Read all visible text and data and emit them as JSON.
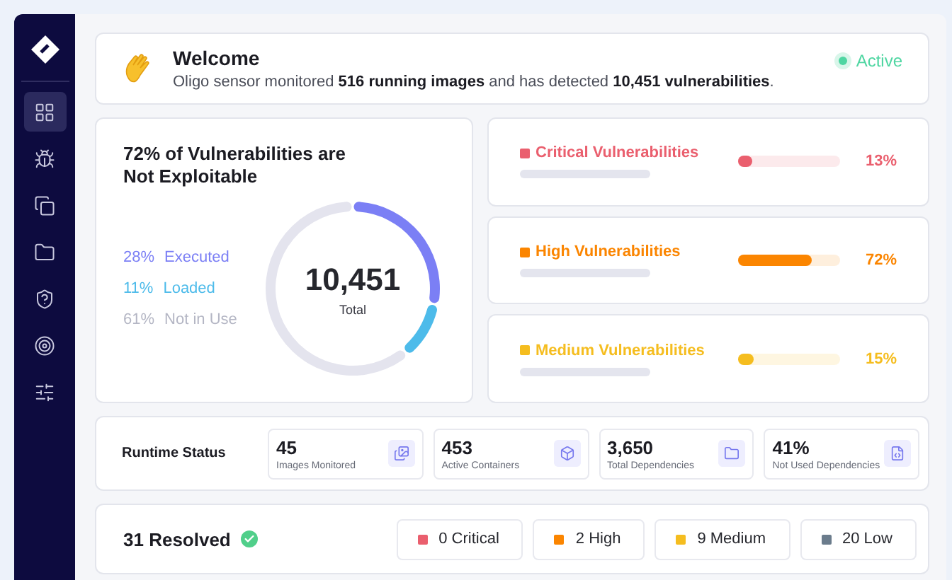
{
  "sidebar": {
    "items": [
      {
        "selected": true
      },
      {
        "selected": false
      },
      {
        "selected": false
      },
      {
        "selected": false
      },
      {
        "selected": false
      },
      {
        "selected": false
      },
      {
        "selected": false
      }
    ]
  },
  "welcome": {
    "title": "Welcome",
    "message": "Oligo sensor monitored **516 running images** and has detected **10,451 vulnerabilities**.",
    "status": "Active"
  },
  "exploitability": {
    "title": "72% of Vulnerabilities are Not Exploitable",
    "total": "10,451",
    "total_label": "Total",
    "legend": [
      {
        "percent": "28%",
        "color": "#7b7ff5"
      },
      {
        "percent": "11%",
        "color": "#4dbbea"
      },
      {
        "percent": "61%",
        "color": "#b4b6c4"
      }
    ],
    "chart_data": {
      "type": "donut",
      "categories": [
        "Executed",
        "Loaded",
        "Not in Use"
      ],
      "values": [
        28,
        11,
        61
      ]
    }
  },
  "severity_cards": [
    {
      "title": "Critical Vulnerabilities",
      "level": 0.13,
      "percent": "13%",
      "color": "#ea5f6e"
    },
    {
      "title": "High Vulnerabilities",
      "level": 0.72,
      "percent": "72%",
      "color": "#fb8500"
    },
    {
      "title": "Medium Vulnerabilities",
      "level": 0.15,
      "percent": "15%",
      "color": "#f5bd1f"
    }
  ],
  "runtime_status": {
    "title": "Runtime Status",
    "stats": [
      {
        "value": "45",
        "label": "Images Monitored"
      },
      {
        "value": "453",
        "label": "Active Containers"
      },
      {
        "value": "3,650",
        "label": "Total Dependencies"
      },
      {
        "value": "41%",
        "label": "Not Used Dependencies"
      }
    ]
  },
  "resolved": {
    "title": "31 Resolved",
    "chips": [
      {
        "label": "0 Critical",
        "color": "#ea5f6e"
      },
      {
        "label": "2 High",
        "color": "#fb8500"
      },
      {
        "label": "9 Medium",
        "color": "#f5bd1f"
      },
      {
        "label": "20 Low",
        "color": "#6b7c8c"
      }
    ]
  }
}
